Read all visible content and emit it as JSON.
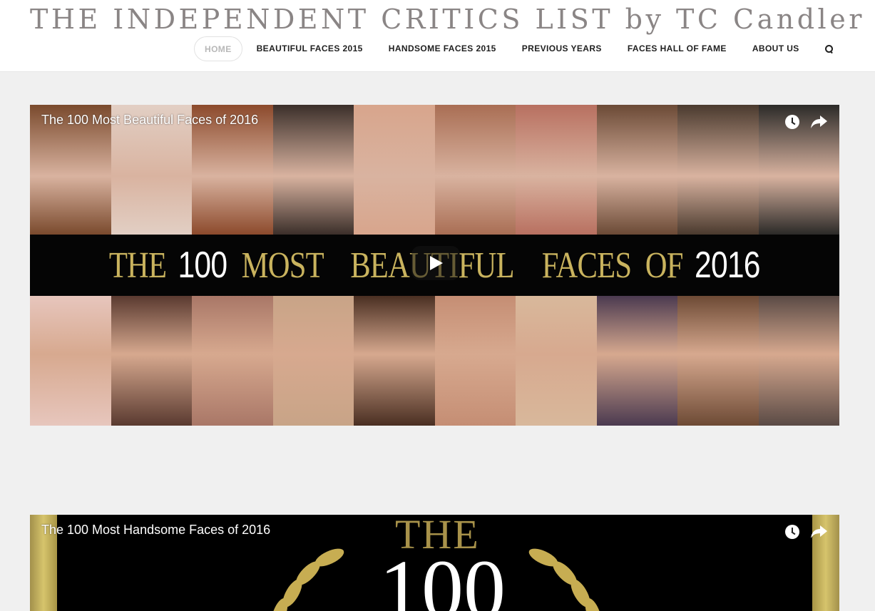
{
  "site": {
    "title": "THE INDEPENDENT CRITICS LIST by TC Candler"
  },
  "nav": {
    "items": [
      {
        "label": "HOME",
        "active": true
      },
      {
        "label": "BEAUTIFUL FACES 2015"
      },
      {
        "label": "HANDSOME FACES 2015"
      },
      {
        "label": "PREVIOUS YEARS"
      },
      {
        "label": "FACES HALL OF FAME"
      },
      {
        "label": "ABOUT US"
      }
    ],
    "search_icon": "search-icon"
  },
  "videos": [
    {
      "title": "The 100 Most Beautiful Faces of 2016",
      "banner": {
        "words": [
          {
            "text": "THE",
            "color": "gold"
          },
          {
            "text": "100",
            "color": "white"
          },
          {
            "text": "MOST",
            "color": "gold"
          },
          {
            "text": "BEAUTIFUL",
            "color": "gold"
          },
          {
            "text": "FACES",
            "color": "gold"
          },
          {
            "text": "OF",
            "color": "gold"
          },
          {
            "text": "2016",
            "color": "white"
          }
        ]
      },
      "thumbnail_top_colors": [
        "#7a4a2d",
        "#e2cfc4",
        "#8c4a2c",
        "#3b2f2a",
        "#d8a58c",
        "#a96e54",
        "#b87060",
        "#6b4a36",
        "#4a3a2e",
        "#2b2a28"
      ],
      "thumbnail_bottom_colors": [
        "#e7c6bd",
        "#5a3a30",
        "#a97767",
        "#c8a487",
        "#4a2f22",
        "#c58e74",
        "#d8b89b",
        "#4b3a50",
        "#6d4a35",
        "#5a4a45"
      ]
    },
    {
      "title": "The 100 Most Handsome Faces of 2016",
      "poster": {
        "the": "THE",
        "number": "100"
      }
    }
  ],
  "icons": {
    "watch_later": "clock-icon",
    "share": "share-icon",
    "play": "play-icon",
    "laurel": "laurel-icon"
  },
  "colors": {
    "gold": "#c9b35e",
    "nav_text": "#1f1f1f",
    "nav_active": "#b8b8b8",
    "title": "#8a8585",
    "page_bg": "#f0f0f0"
  }
}
